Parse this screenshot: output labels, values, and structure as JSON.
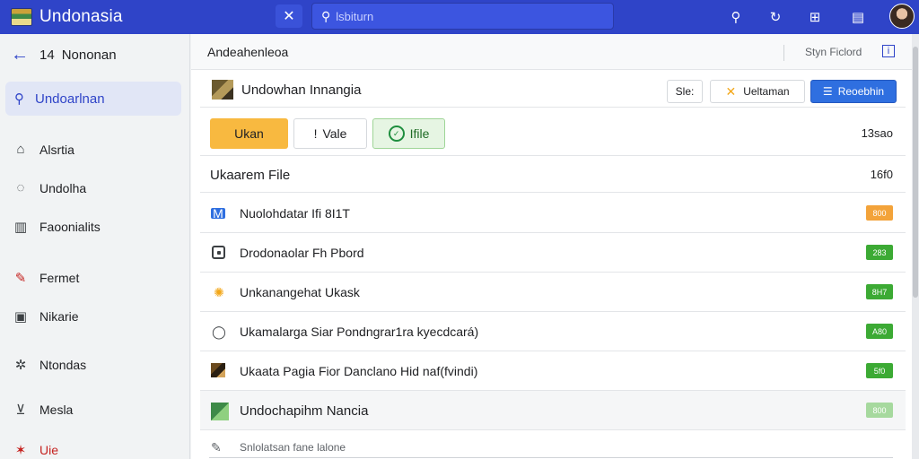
{
  "header": {
    "app_title": "Undonasia",
    "search_placeholder": "lsbiturn",
    "icons": [
      "close-icon",
      "search-icon",
      "refresh-icon",
      "grid-icon",
      "menu-icon"
    ]
  },
  "sidebar": {
    "back_number": "14",
    "back_label": "Nononan",
    "search_label": "Undoarlnan",
    "items": [
      {
        "label": "Alsrtia",
        "icon": "home-icon"
      },
      {
        "label": "Undolha",
        "icon": "chat-icon"
      },
      {
        "label": "Faoonialits",
        "icon": "chart-icon"
      },
      {
        "label": "Fermet",
        "icon": "pencil-icon"
      },
      {
        "label": "Nikarie",
        "icon": "briefcase-icon"
      },
      {
        "label": "Ntondas",
        "icon": "settings-icon"
      },
      {
        "label": "Mesla",
        "icon": "download-icon"
      },
      {
        "label": "Uie",
        "icon": "star-icon"
      }
    ]
  },
  "main": {
    "breadcrumb": "Andeahenleoa",
    "sign_label": "Styn Ficlord",
    "document": {
      "title": "Undowhan Innangia",
      "btn_site": "Sle:",
      "btn_dismiss": "Ueltaman",
      "btn_primary": "Reoebhin"
    },
    "actions": {
      "orange": "Ukan",
      "white": "Vale",
      "green": "Ifile",
      "right_value": "13sao"
    },
    "file_header": {
      "label": "Ukaarem File",
      "value": "16f0"
    },
    "rows": [
      {
        "text": "Nuolohdatar Ifi 8I1T",
        "badge": "800",
        "badge_color": "#f3a33a",
        "icon": "mail-icon"
      },
      {
        "text": "Drodonaolar Fh Pbord",
        "badge": "283",
        "badge_color": "#3caa34",
        "icon": "square-icon"
      },
      {
        "text": "Unkanangehat Ukask",
        "badge": "8H7",
        "badge_color": "#3caa34",
        "icon": "sun-icon"
      },
      {
        "text": "Ukamalarga Siar Pondngrar1ra kyecdcará)",
        "badge": "A80",
        "badge_color": "#3caa34",
        "icon": "chat-bubble-icon"
      },
      {
        "text": "Ukaata Pagia Fior Danclano Hid naf(fvindi)",
        "badge": "5f0",
        "badge_color": "#3caa34",
        "icon": "picture-icon"
      },
      {
        "text": "Undochapihm Nancia",
        "badge": "800",
        "badge_color": "#a6d99e",
        "icon": "green-picture-icon"
      }
    ],
    "partial_row": "Snlolatsan fane lalone"
  }
}
